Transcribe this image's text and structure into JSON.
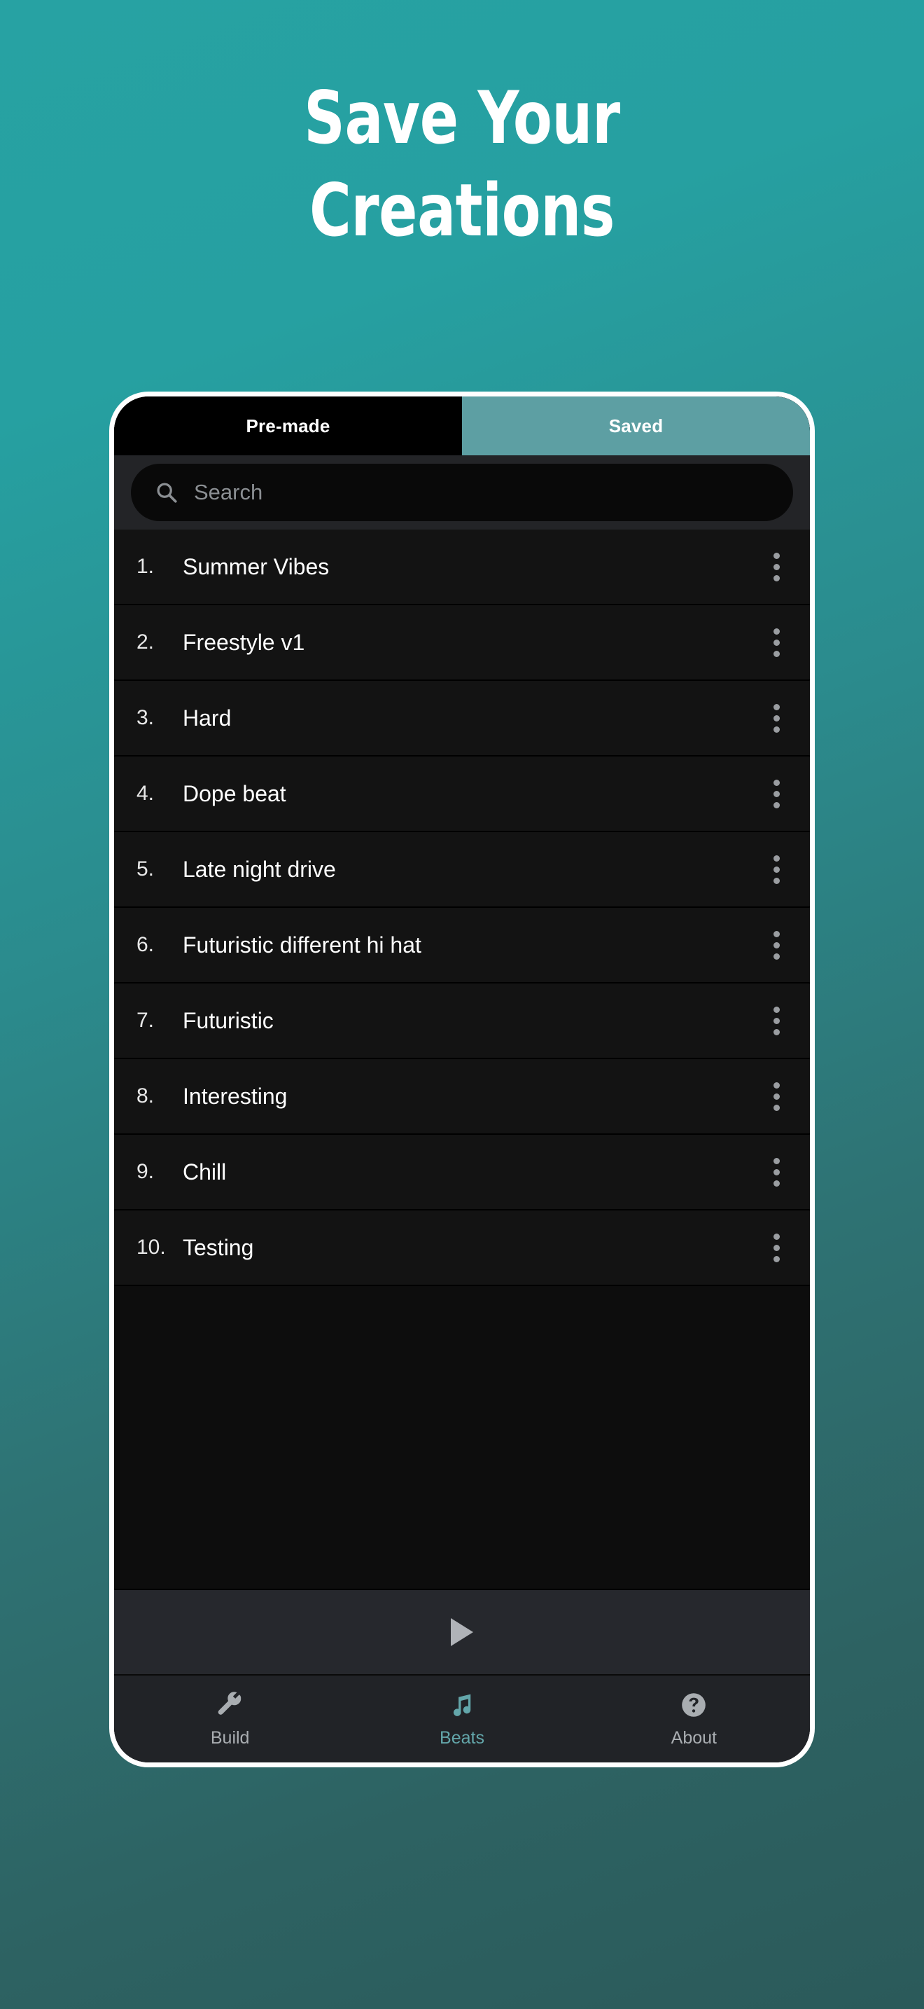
{
  "promo": {
    "headline_line1": "Save Your",
    "headline_line2": "Creations",
    "background_top_color": "#27a2a3",
    "background_bottom_color": "#2b5a5a",
    "headline_color": "#ffffff"
  },
  "app": {
    "top_tabs": [
      {
        "label": "Pre-made",
        "selected": false,
        "name": "tab-pre-made"
      },
      {
        "label": "Saved",
        "selected": true,
        "name": "tab-saved",
        "color": "#5d9fa3"
      }
    ],
    "search": {
      "placeholder": "Search",
      "value": "",
      "icon": "search-icon"
    },
    "list": {
      "rows": [
        {
          "index": "1.",
          "title": "Summer Vibes",
          "menu_icon": "kebab-menu-icon"
        },
        {
          "index": "2.",
          "title": "Freestyle v1",
          "menu_icon": "kebab-menu-icon"
        },
        {
          "index": "3.",
          "title": "Hard",
          "menu_icon": "kebab-menu-icon"
        },
        {
          "index": "4.",
          "title": "Dope beat",
          "menu_icon": "kebab-menu-icon"
        },
        {
          "index": "5.",
          "title": "Late night drive",
          "menu_icon": "kebab-menu-icon"
        },
        {
          "index": "6.",
          "title": "Futuristic different hi hat",
          "menu_icon": "kebab-menu-icon"
        },
        {
          "index": "7.",
          "title": "Futuristic",
          "menu_icon": "kebab-menu-icon"
        },
        {
          "index": "8.",
          "title": "Interesting",
          "menu_icon": "kebab-menu-icon"
        },
        {
          "index": "9.",
          "title": "Chill",
          "menu_icon": "kebab-menu-icon"
        },
        {
          "index": "10.",
          "title": "Testing",
          "menu_icon": "kebab-menu-icon"
        }
      ]
    },
    "transport": {
      "play_icon": "play-icon"
    },
    "bottom_nav": [
      {
        "label": "Build",
        "icon": "wrench-icon",
        "active": false,
        "color": "#a9adb1"
      },
      {
        "label": "Beats",
        "icon": "music-note-icon",
        "active": true,
        "color": "#63a6aa"
      },
      {
        "label": "About",
        "icon": "question-circle-icon",
        "active": false,
        "color": "#a9adb1"
      }
    ]
  }
}
